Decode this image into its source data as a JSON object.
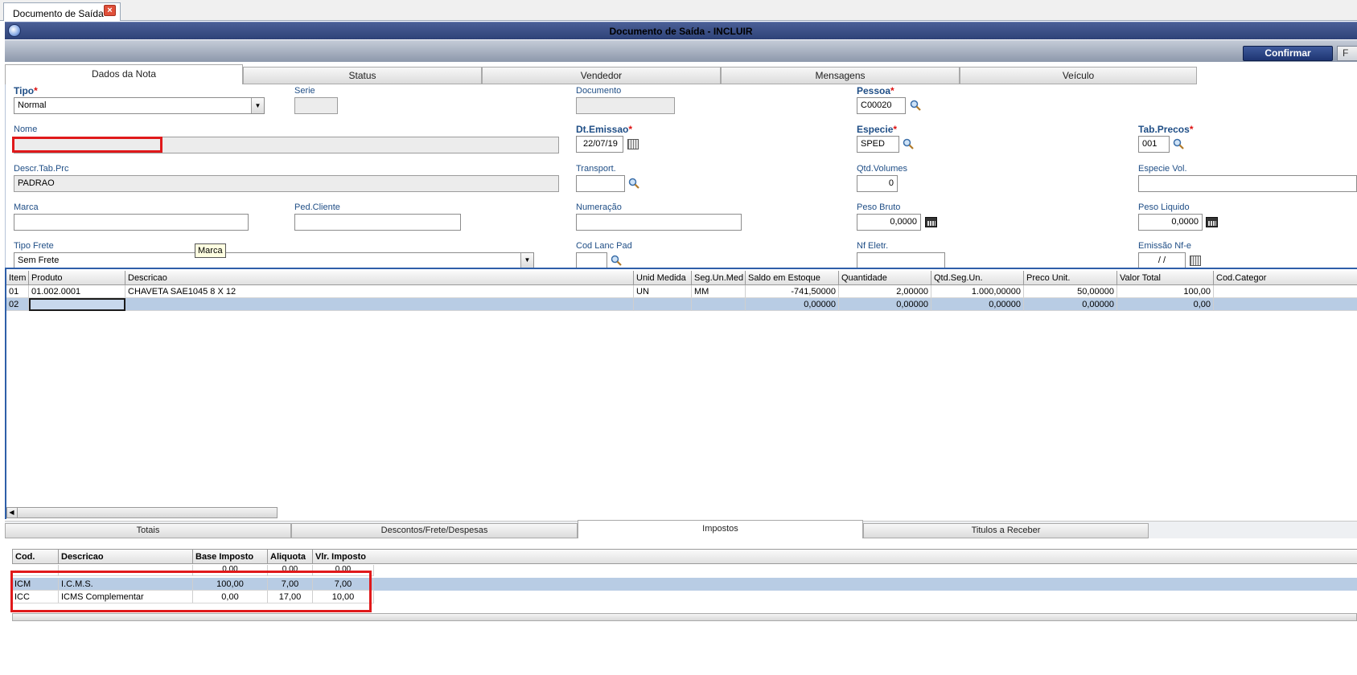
{
  "outer_tab": {
    "label": "Documento de Saída"
  },
  "window": {
    "title": "Documento de Saída - INCLUIR"
  },
  "toolbar": {
    "confirm_label": "Confirmar",
    "next_label": "F"
  },
  "tabs": [
    "Dados da Nota",
    "Status",
    "Vendedor",
    "Mensagens",
    "Veículo"
  ],
  "form": {
    "tipo": {
      "label": "Tipo",
      "value": "Normal"
    },
    "serie": {
      "label": "Serie",
      "value": ""
    },
    "documento": {
      "label": "Documento",
      "value": ""
    },
    "pessoa": {
      "label": "Pessoa",
      "value": "C00020"
    },
    "nome": {
      "label": "Nome",
      "value": ""
    },
    "dt_emissao": {
      "label": "Dt.Emissao",
      "value": "22/07/19"
    },
    "especie": {
      "label": "Especie",
      "value": "SPED"
    },
    "tab_precos": {
      "label": "Tab.Precos",
      "value": "001"
    },
    "descr_tab_prc": {
      "label": "Descr.Tab.Prc",
      "value": "PADRAO"
    },
    "transport": {
      "label": "Transport.",
      "value": ""
    },
    "qtd_volumes": {
      "label": "Qtd.Volumes",
      "value": "0"
    },
    "especie_vol": {
      "label": "Especie Vol.",
      "value": ""
    },
    "marca": {
      "label": "Marca",
      "value": ""
    },
    "ped_cliente": {
      "label": "Ped.Cliente",
      "value": ""
    },
    "numeracao": {
      "label": "Numeração",
      "value": ""
    },
    "peso_bruto": {
      "label": "Peso Bruto",
      "value": "0,0000"
    },
    "peso_liquido": {
      "label": "Peso Liquido",
      "value": "0,0000"
    },
    "tipo_frete": {
      "label": "Tipo Frete",
      "value": "Sem Frete"
    },
    "cod_lanc_pad": {
      "label": "Cod Lanc Pad",
      "value": ""
    },
    "nf_eletr": {
      "label": "Nf Eletr.",
      "value": ""
    },
    "emissao_nfe": {
      "label": "Emissão Nf-e",
      "value": "/ /"
    }
  },
  "tooltip": "Marca",
  "items_grid": {
    "headers": [
      "Item",
      "Produto",
      "Descricao",
      "Unid Medida",
      "Seg.Un.Med",
      "Saldo em Estoque",
      "Quantidade",
      "Qtd.Seg.Un.",
      "Preco Unit.",
      "Valor Total",
      "Cod.Categor"
    ],
    "rows": [
      [
        "01",
        "01.002.0001",
        "CHAVETA SAE1045  8 X 12",
        "UN",
        "MM",
        "-741,50000",
        "2,00000",
        "1.000,00000",
        "50,00000",
        "100,00",
        ""
      ],
      [
        "02",
        "",
        "",
        "",
        "",
        "0,00000",
        "0,00000",
        "0,00000",
        "0,00000",
        "0,00",
        ""
      ]
    ]
  },
  "bottom_tabs": [
    "Totais",
    "Descontos/Frete/Despesas",
    "Impostos",
    "Titulos a Receber"
  ],
  "tax_grid": {
    "headers": [
      "Cod.",
      "Descricao",
      "Base Imposto",
      "Aliquota",
      "Vlr. Imposto"
    ],
    "rows": [
      [
        "...",
        "",
        "0,00",
        "0,00",
        "0,00"
      ],
      [
        "ICM",
        "I.C.M.S.",
        "100,00",
        "7,00",
        "7,00"
      ],
      [
        "ICC",
        "ICMS Complementar",
        "0,00",
        "17,00",
        "10,00"
      ]
    ]
  },
  "colors": {
    "titlebar": "#2e4278",
    "accent": "#2f5fa9",
    "highlight_box": "#e0191b",
    "selected_row": "#b8cce4"
  }
}
